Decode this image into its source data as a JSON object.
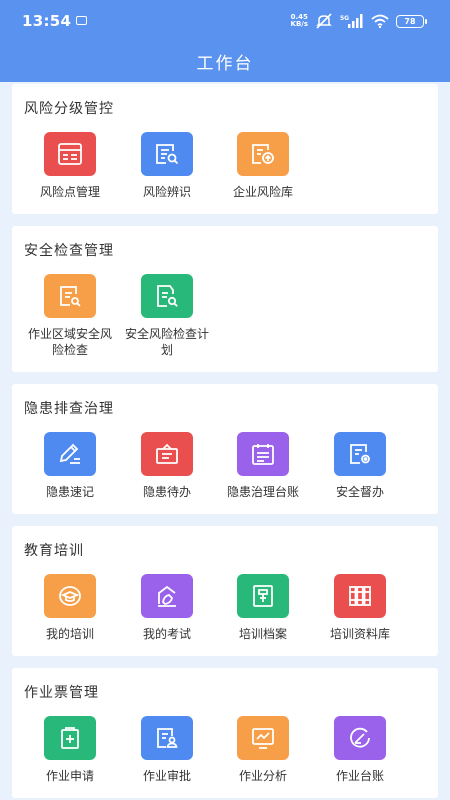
{
  "status": {
    "time": "13:54",
    "net_speed": "0.45",
    "net_unit": "KB/s",
    "signal_label": "5G",
    "battery": "78"
  },
  "header": {
    "title": "工作台"
  },
  "sections": [
    {
      "title": "风险分级管控",
      "items": [
        {
          "label": "风险点管理",
          "icon": "risk-point-icon",
          "color": "#ea4f4f"
        },
        {
          "label": "风险辨识",
          "icon": "risk-identify-icon",
          "color": "#4f8af1"
        },
        {
          "label": "企业风险库",
          "icon": "risk-library-icon",
          "color": "#f79e49"
        }
      ]
    },
    {
      "title": "安全检查管理",
      "items": [
        {
          "label": "作业区域安全风险检查",
          "icon": "area-check-icon",
          "color": "#f79e49"
        },
        {
          "label": "安全风险检查计划",
          "icon": "check-plan-icon",
          "color": "#28b97a"
        }
      ]
    },
    {
      "title": "隐患排查治理",
      "items": [
        {
          "label": "隐患速记",
          "icon": "pen-note-icon",
          "color": "#4f8af1"
        },
        {
          "label": "隐患待办",
          "icon": "todo-icon",
          "color": "#ea4f4f"
        },
        {
          "label": "隐患治理台账",
          "icon": "calendar-ledger-icon",
          "color": "#9a62ea"
        },
        {
          "label": "安全督办",
          "icon": "supervise-icon",
          "color": "#4f8af1"
        }
      ]
    },
    {
      "title": "教育培训",
      "items": [
        {
          "label": "我的培训",
          "icon": "graduation-cap-icon",
          "color": "#f79e49"
        },
        {
          "label": "我的考试",
          "icon": "exam-icon",
          "color": "#9a62ea"
        },
        {
          "label": "培训档案",
          "icon": "archive-icon",
          "color": "#28b97a"
        },
        {
          "label": "培训资料库",
          "icon": "books-icon",
          "color": "#ea4f4f"
        }
      ]
    },
    {
      "title": "作业票管理",
      "items": [
        {
          "label": "作业申请",
          "icon": "apply-icon",
          "color": "#28b97a"
        },
        {
          "label": "作业审批",
          "icon": "approve-icon",
          "color": "#4f8af1"
        },
        {
          "label": "作业分析",
          "icon": "analysis-icon",
          "color": "#f79e49"
        },
        {
          "label": "作业台账",
          "icon": "work-ledger-icon",
          "color": "#9a62ea"
        }
      ]
    }
  ]
}
